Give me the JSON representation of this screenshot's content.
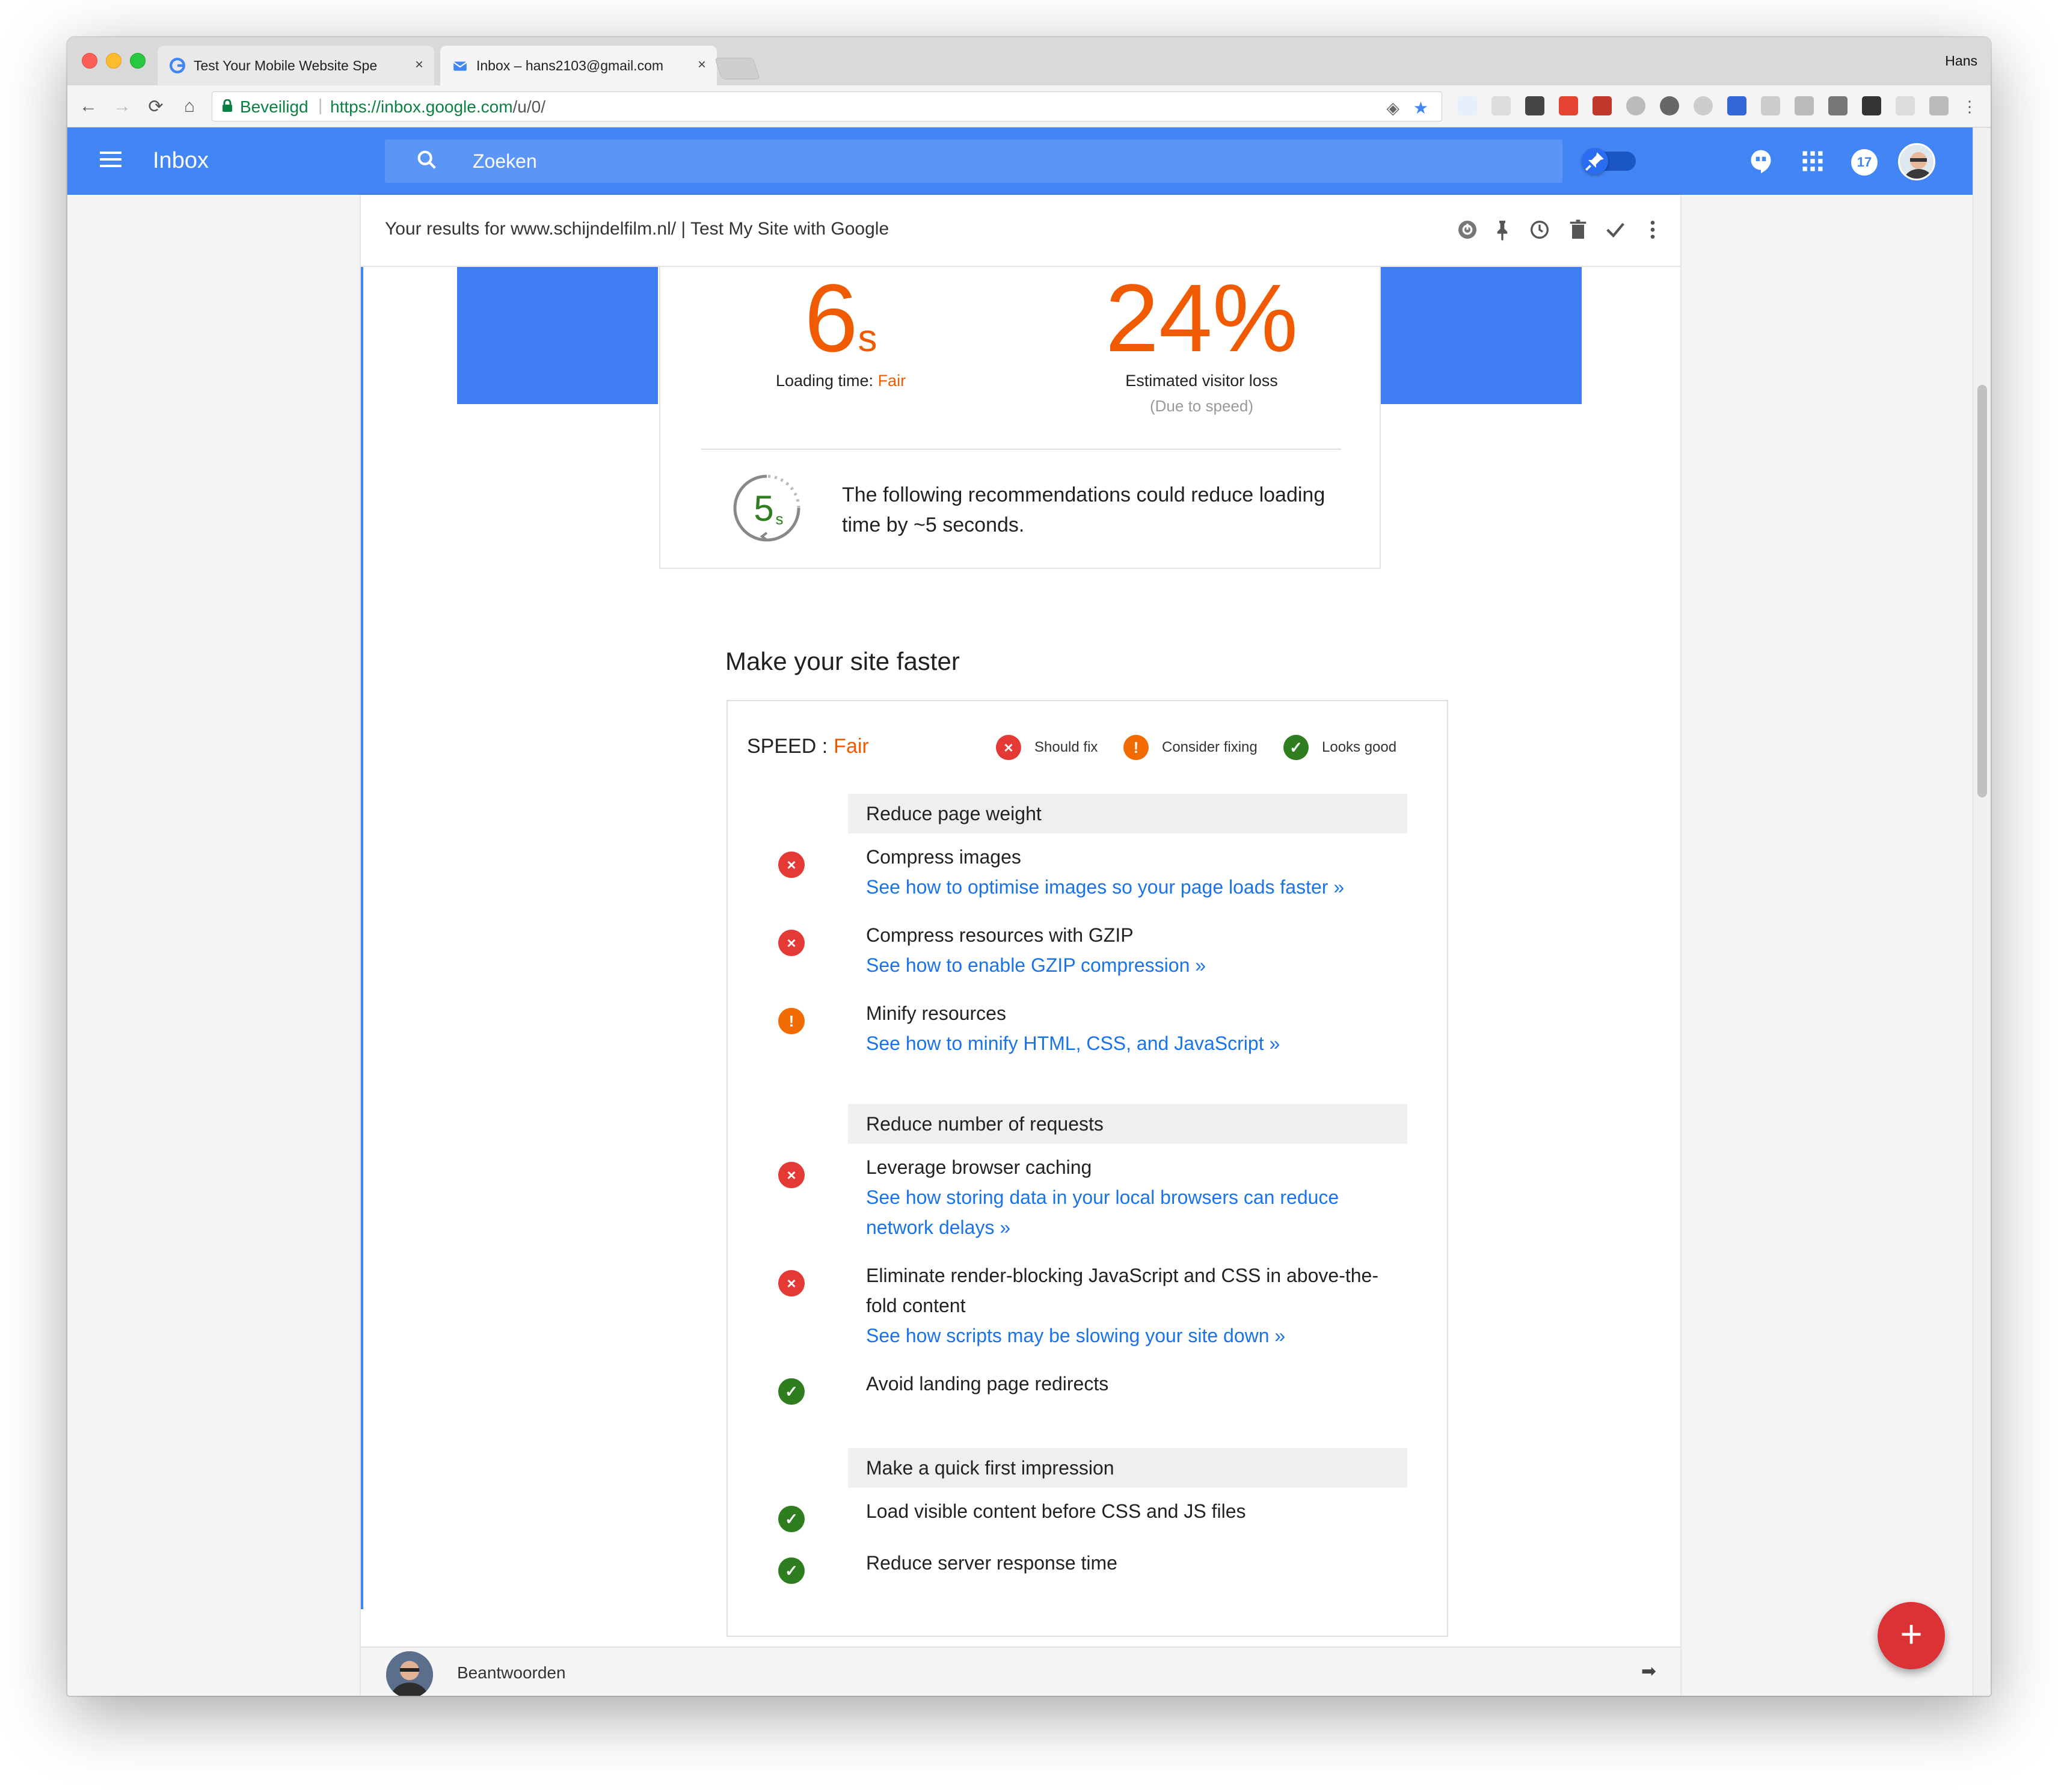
{
  "browser": {
    "tabs": [
      {
        "title": "Test Your Mobile Website Spe",
        "favicon": "google-g-icon",
        "active": false
      },
      {
        "title": "Inbox – hans2103@gmail.com",
        "favicon": "inbox-icon",
        "active": true
      }
    ],
    "profile": "Hans",
    "secure_label": "Beveiligd",
    "url_host": "https://inbox.google.com",
    "url_path": "/u/0/"
  },
  "app": {
    "brand": "Inbox",
    "search_placeholder": "Zoeken",
    "notification_count": "17",
    "accent": "#4285f4"
  },
  "message": {
    "subject": "Your results for www.schijndelfilm.nl/ | Test My Site with Google",
    "loading_time_value": "6",
    "loading_time_unit": "s",
    "loading_time_label": "Loading time:",
    "loading_time_rating": "Fair",
    "visitor_loss_value": "24%",
    "visitor_loss_label": "Estimated visitor loss",
    "visitor_loss_sub": "(Due to speed)",
    "savings_value": "5",
    "savings_unit": "s",
    "recommendation_text": "The following recommendations could reduce loading time by ~5 seconds.",
    "section_title": "Make your site faster",
    "speed_label": "SPEED :",
    "speed_rating": "Fair",
    "legend": {
      "should_fix": "Should fix",
      "consider_fixing": "Consider fixing",
      "looks_good": "Looks good"
    },
    "groups": [
      {
        "title": "Reduce page weight"
      },
      {
        "title": "Reduce number of requests"
      },
      {
        "title": "Make a quick first impression"
      }
    ],
    "items": [
      {
        "status": "should-fix",
        "title": "Compress images",
        "link": "See how to optimise images so your page loads faster »"
      },
      {
        "status": "should-fix",
        "title": "Compress resources with GZIP",
        "link": "See how to enable GZIP compression »"
      },
      {
        "status": "consider-fixing",
        "title": "Minify resources",
        "link": "See how to minify HTML, CSS, and JavaScript »"
      },
      {
        "status": "should-fix",
        "title": "Leverage browser caching",
        "link": "See how storing data in your local browsers can reduce network delays »"
      },
      {
        "status": "should-fix",
        "title": "Eliminate render-blocking JavaScript and CSS in above-the-fold content",
        "link": "See how scripts may be slowing your site down »"
      },
      {
        "status": "looks-good",
        "title": "Avoid landing page redirects",
        "link": ""
      },
      {
        "status": "looks-good",
        "title": "Load visible content before CSS and JS files",
        "link": ""
      },
      {
        "status": "looks-good",
        "title": "Reduce server response time",
        "link": ""
      }
    ],
    "reply_label": "Beantwoorden"
  },
  "colors": {
    "fair": "#f05a00",
    "should_fix": "#e53935",
    "consider_fixing": "#f26b00",
    "looks_good": "#2e7d1f",
    "link": "#1a73e8",
    "fab": "#db3236"
  }
}
